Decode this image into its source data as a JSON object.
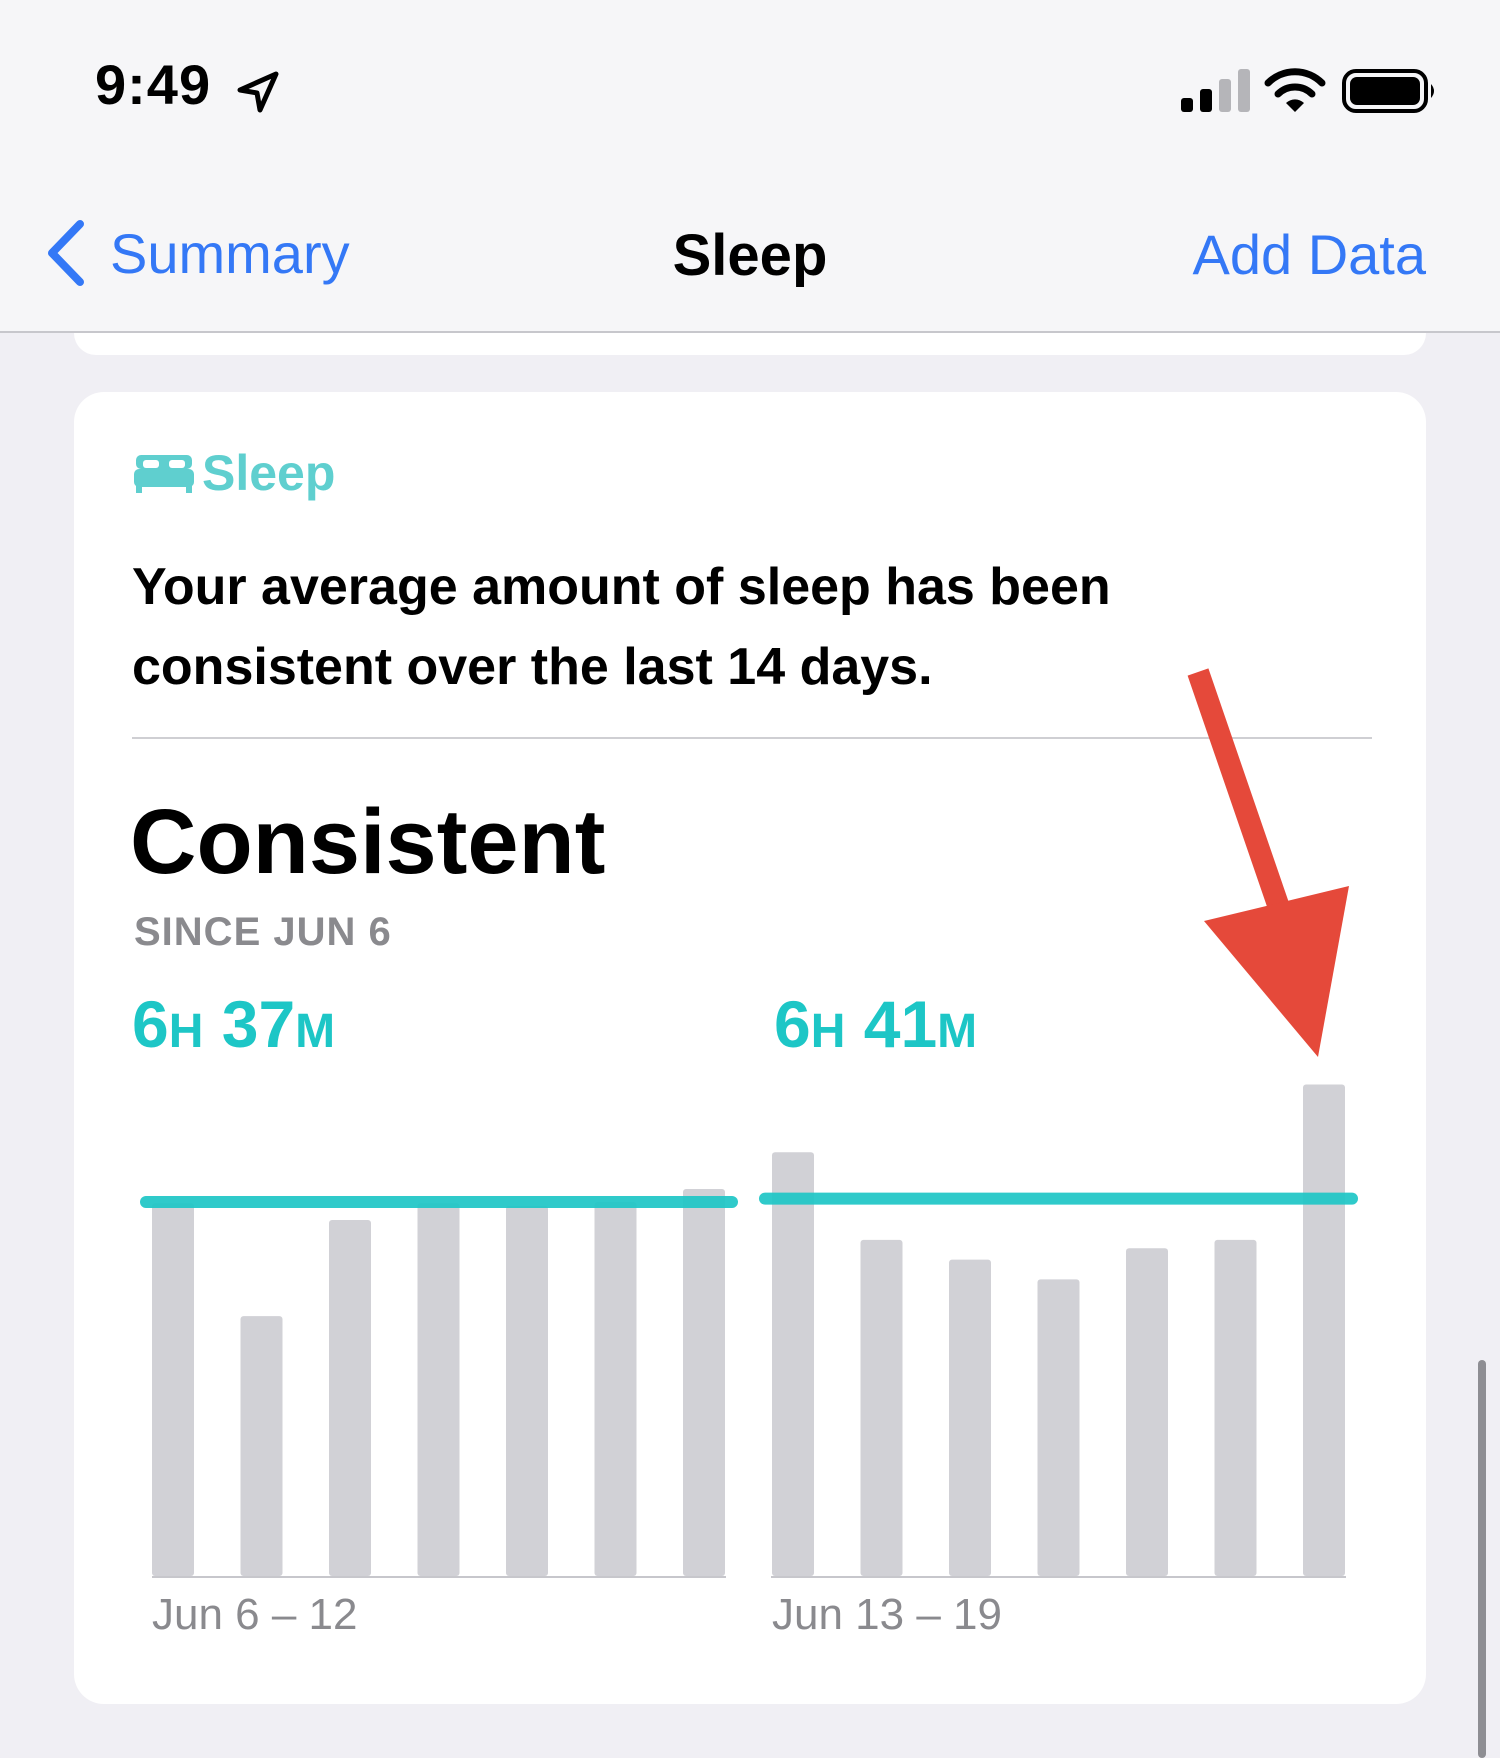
{
  "status_bar": {
    "time": "9:49",
    "icons": [
      "location-arrow-icon",
      "cellular-signal-icon",
      "wifi-icon",
      "battery-icon"
    ]
  },
  "nav": {
    "back_label": "Summary",
    "title": "Sleep",
    "action_label": "Add Data",
    "accent_color": "#3478f6"
  },
  "card": {
    "header_icon": "bed-icon",
    "header_label": "Sleep",
    "header_color": "#5fcfcf",
    "summary": "Your average amount of sleep has been consistent over the last 14 days.",
    "status": "Consistent",
    "since": "SINCE JUN 6",
    "periods": [
      {
        "avg_hours": "6",
        "avg_h_unit": "H",
        "avg_minutes": "37",
        "avg_m_unit": "M",
        "range": "Jun 6 – 12"
      },
      {
        "avg_hours": "6",
        "avg_h_unit": "H",
        "avg_minutes": "41",
        "avg_m_unit": "M",
        "range": "Jun 13 – 19"
      }
    ]
  },
  "chart_data": {
    "type": "bar",
    "series": [
      {
        "values": [
          6.6,
          4.6,
          6.3,
          6.6,
          6.55,
          6.62,
          6.85
        ],
        "average": 6.62
      },
      {
        "values": [
          7.5,
          5.95,
          5.6,
          5.25,
          5.8,
          5.95,
          8.7
        ],
        "average": 6.68
      }
    ],
    "bar_color": "#d1d1d6",
    "average_line_color": "#1dc6c6"
  },
  "annotation": {
    "type": "arrow",
    "color": "#e5493a"
  }
}
